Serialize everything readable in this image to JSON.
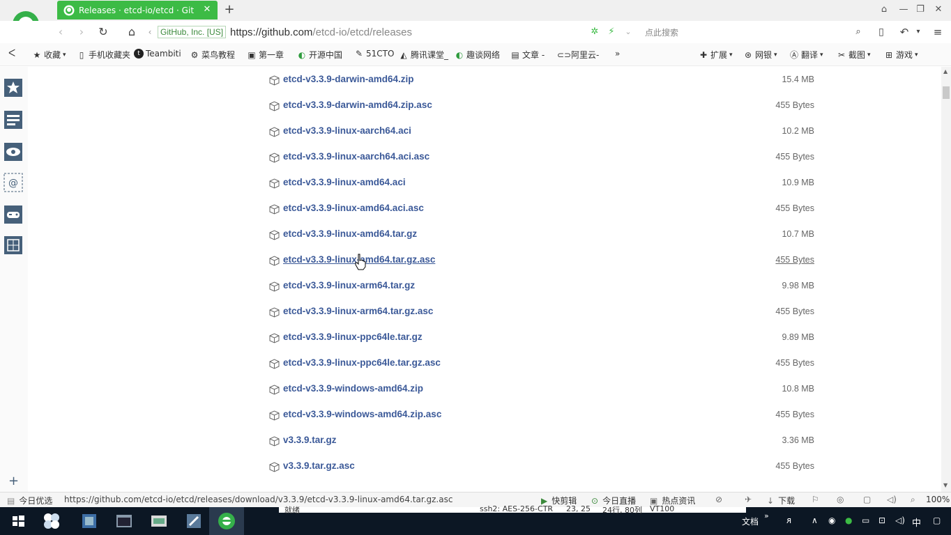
{
  "browser": {
    "tab_title": "Releases · etcd-io/etcd · Git",
    "new_tab": "+",
    "url_ev": "GitHub, Inc. [US]",
    "url_host": "https://github.com",
    "url_path": "/etcd-io/etcd/releases",
    "search_placeholder": "点此搜索"
  },
  "bookmarks": [
    {
      "label": "收藏",
      "icon": "star-icon"
    },
    {
      "label": "手机收藏夹",
      "icon": "phone-icon"
    },
    {
      "label": "Teambiti",
      "icon": "teambition-icon"
    },
    {
      "label": "菜鸟教程",
      "icon": "runoob-icon"
    },
    {
      "label": "第一章",
      "icon": "page-icon"
    },
    {
      "label": "开源中国",
      "icon": "oschina-icon"
    },
    {
      "label": "51CTO",
      "icon": "51cto-icon"
    },
    {
      "label": "腾讯课堂_",
      "icon": "tencent-icon"
    },
    {
      "label": "趣谈网络",
      "icon": "geektime-icon"
    },
    {
      "label": "文章 -",
      "icon": "doc-icon"
    },
    {
      "label": "阿里云-",
      "icon": "aliyun-icon"
    },
    {
      "label": "»",
      "icon": "more-icon"
    }
  ],
  "extras": [
    {
      "label": "扩展",
      "icon": "puzzle-icon"
    },
    {
      "label": "网银",
      "icon": "bank-icon"
    },
    {
      "label": "翻译",
      "icon": "translate-icon"
    },
    {
      "label": "截图",
      "icon": "scissors-icon"
    },
    {
      "label": "游戏",
      "icon": "gamepad-icon"
    }
  ],
  "assets": [
    {
      "name": "etcd-v3.3.9-darwin-amd64.zip",
      "size": "15.4 MB"
    },
    {
      "name": "etcd-v3.3.9-darwin-amd64.zip.asc",
      "size": "455 Bytes"
    },
    {
      "name": "etcd-v3.3.9-linux-aarch64.aci",
      "size": "10.2 MB"
    },
    {
      "name": "etcd-v3.3.9-linux-aarch64.aci.asc",
      "size": "455 Bytes"
    },
    {
      "name": "etcd-v3.3.9-linux-amd64.aci",
      "size": "10.9 MB"
    },
    {
      "name": "etcd-v3.3.9-linux-amd64.aci.asc",
      "size": "455 Bytes"
    },
    {
      "name": "etcd-v3.3.9-linux-amd64.tar.gz",
      "size": "10.7 MB"
    },
    {
      "name": "etcd-v3.3.9-linux-amd64.tar.gz.asc",
      "size": "455 Bytes"
    },
    {
      "name": "etcd-v3.3.9-linux-arm64.tar.gz",
      "size": "9.98 MB"
    },
    {
      "name": "etcd-v3.3.9-linux-arm64.tar.gz.asc",
      "size": "455 Bytes"
    },
    {
      "name": "etcd-v3.3.9-linux-ppc64le.tar.gz",
      "size": "9.89 MB"
    },
    {
      "name": "etcd-v3.3.9-linux-ppc64le.tar.gz.asc",
      "size": "455 Bytes"
    },
    {
      "name": "etcd-v3.3.9-windows-amd64.zip",
      "size": "10.8 MB"
    },
    {
      "name": "etcd-v3.3.9-windows-amd64.zip.asc",
      "size": "455 Bytes"
    },
    {
      "name": "v3.3.9.tar.gz",
      "size": "3.36 MB"
    },
    {
      "name": "v3.3.9.tar.gz.asc",
      "size": "455 Bytes"
    }
  ],
  "status": {
    "today": "今日优选",
    "link_url": "https://github.com/etcd-io/etcd/releases/download/v3.3.9/etcd-v3.3.9-linux-amd64.tar.gz.asc",
    "items": [
      "快剪辑",
      "今日直播",
      "热点资讯",
      "下载"
    ],
    "zoom": "100%"
  },
  "taskbar": {
    "status_text": "就绪",
    "ssh": "ssh2: AES-256-CTR",
    "pos": "23, 25",
    "rows": "24行, 80列",
    "term": "VT100",
    "doc": "文档",
    "ime": "中"
  }
}
